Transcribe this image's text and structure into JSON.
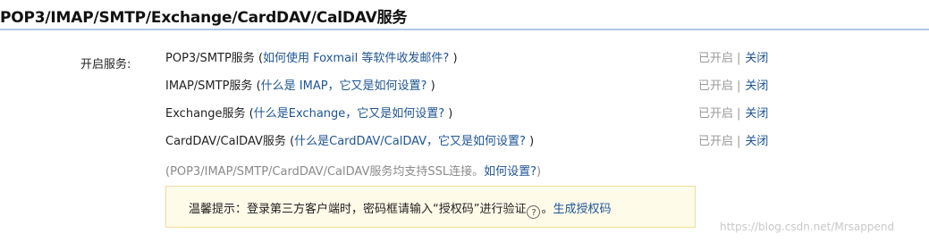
{
  "page": {
    "title": "POP3/IMAP/SMTP/Exchange/CardDAV/CalDAV服务",
    "section_label": "开启服务:"
  },
  "services": [
    {
      "name": "POP3/SMTP服务",
      "help": "如何使用 Foxmail 等软件收发邮件?",
      "status": "已开启",
      "action": "关闭"
    },
    {
      "name": "IMAP/SMTP服务",
      "help": "什么是 IMAP，它又是如何设置?",
      "status": "已开启",
      "action": "关闭"
    },
    {
      "name": "Exchange服务",
      "help": "什么是Exchange，它又是如何设置?",
      "status": "已开启",
      "action": "关闭"
    },
    {
      "name": "CardDAV/CalDAV服务",
      "help": "什么是CardDAV/CalDAV，它又是如何设置?",
      "status": "已开启",
      "action": "关闭"
    }
  ],
  "ssl_note": {
    "text": "(POP3/IMAP/SMTP/CardDAV/CalDAV服务均支持SSL连接。",
    "link": "如何设置?",
    "close_paren": ")"
  },
  "tip": {
    "text": "温馨提示：登录第三方客户端时，密码框请输入“授权码”进行验证",
    "icon": "?",
    "period": "。",
    "link": "生成授权码"
  },
  "watermark": "https://blog.csdn.net/Mrsappend",
  "colors": {
    "link": "#1e5494",
    "rule": "#aec8ea",
    "tip_bg": "#fffbe9",
    "tip_border": "#f3dc9e",
    "muted": "#999999"
  }
}
